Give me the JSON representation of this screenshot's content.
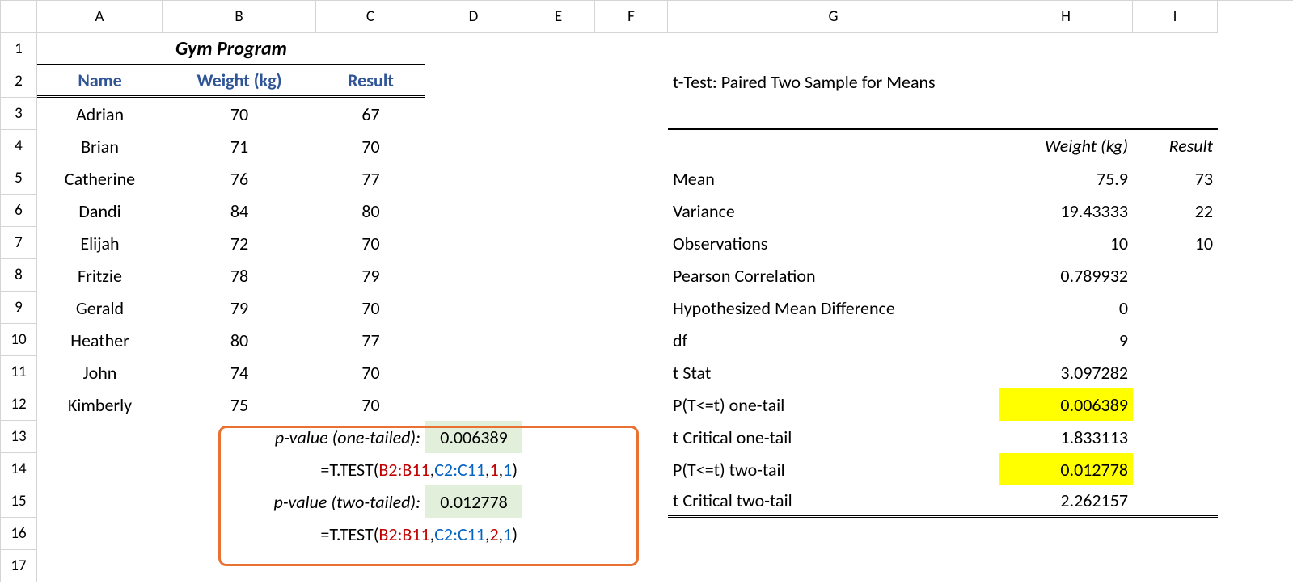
{
  "columns": [
    "A",
    "B",
    "C",
    "D",
    "E",
    "F",
    "G",
    "H",
    "I"
  ],
  "rownums": [
    "1",
    "2",
    "3",
    "4",
    "5",
    "6",
    "7",
    "8",
    "9",
    "10",
    "11",
    "12",
    "13",
    "14",
    "15",
    "16",
    "17"
  ],
  "gym": {
    "title": "Gym Program",
    "headers": {
      "name": "Name",
      "weight": "Weight (kg)",
      "result": "Result"
    },
    "rows": [
      {
        "name": "Adrian",
        "weight": "70",
        "result": "67"
      },
      {
        "name": "Brian",
        "weight": "71",
        "result": "70"
      },
      {
        "name": "Catherine",
        "weight": "76",
        "result": "77"
      },
      {
        "name": "Dandi",
        "weight": "84",
        "result": "80"
      },
      {
        "name": "Elijah",
        "weight": "72",
        "result": "70"
      },
      {
        "name": "Fritzie",
        "weight": "78",
        "result": "79"
      },
      {
        "name": "Gerald",
        "weight": "79",
        "result": "70"
      },
      {
        "name": "Heather",
        "weight": "80",
        "result": "77"
      },
      {
        "name": "John",
        "weight": "74",
        "result": "70"
      },
      {
        "name": "Kimberly",
        "weight": "75",
        "result": "70"
      }
    ]
  },
  "pvalue": {
    "one_label": "p-value (one-tailed):",
    "one_value": "0.006389",
    "one_formula_prefix": "=T.TEST(",
    "one_formula_a": "B2:B11",
    "one_formula_b": "C2:C11",
    "one_formula_c": "1",
    "one_formula_d": "1",
    "two_label": "p-value (two-tailed):",
    "two_value": "0.012778",
    "two_formula_prefix": "=T.TEST(",
    "two_formula_a": "B2:B11",
    "two_formula_b": "C2:C11",
    "two_formula_c": "2",
    "two_formula_d": "1"
  },
  "ttest": {
    "title": "t-Test: Paired Two Sample for Means",
    "headers": {
      "weight": "Weight (kg)",
      "result": "Result"
    },
    "rows": [
      {
        "label": "Mean",
        "h": "75.9",
        "i": "73"
      },
      {
        "label": "Variance",
        "h": "19.43333",
        "i": "22"
      },
      {
        "label": "Observations",
        "h": "10",
        "i": "10"
      },
      {
        "label": "Pearson Correlation",
        "h": "0.789932",
        "i": ""
      },
      {
        "label": "Hypothesized Mean Difference",
        "h": "0",
        "i": ""
      },
      {
        "label": "df",
        "h": "9",
        "i": ""
      },
      {
        "label": "t Stat",
        "h": "3.097282",
        "i": ""
      },
      {
        "label": "P(T<=t) one-tail",
        "h": "0.006389",
        "i": "",
        "hl": true
      },
      {
        "label": "t Critical one-tail",
        "h": "1.833113",
        "i": ""
      },
      {
        "label": "P(T<=t) two-tail",
        "h": "0.012778",
        "i": "",
        "hl": true
      },
      {
        "label": "t Critical two-tail",
        "h": "2.262157",
        "i": ""
      }
    ]
  },
  "chart_data": {
    "type": "table",
    "title": "t-Test: Paired Two Sample for Means",
    "input_data": {
      "participants": [
        "Adrian",
        "Brian",
        "Catherine",
        "Dandi",
        "Elijah",
        "Fritzie",
        "Gerald",
        "Heather",
        "John",
        "Kimberly"
      ],
      "weight_kg": [
        70,
        71,
        76,
        84,
        72,
        78,
        79,
        80,
        74,
        75
      ],
      "result": [
        67,
        70,
        77,
        80,
        70,
        79,
        70,
        77,
        70,
        70
      ]
    },
    "statistics": {
      "Mean": {
        "weight": 75.9,
        "result": 73
      },
      "Variance": {
        "weight": 19.43333,
        "result": 22
      },
      "Observations": {
        "weight": 10,
        "result": 10
      },
      "Pearson Correlation": 0.789932,
      "Hypothesized Mean Difference": 0,
      "df": 9,
      "t Stat": 3.097282,
      "P(T<=t) one-tail": 0.006389,
      "t Critical one-tail": 1.833113,
      "P(T<=t) two-tail": 0.012778,
      "t Critical two-tail": 2.262157
    },
    "t_test_formulas": {
      "one_tailed": {
        "formula": "=T.TEST(B2:B11,C2:C11,1,1)",
        "value": 0.006389
      },
      "two_tailed": {
        "formula": "=T.TEST(B2:B11,C2:C11,2,1)",
        "value": 0.012778
      }
    }
  }
}
